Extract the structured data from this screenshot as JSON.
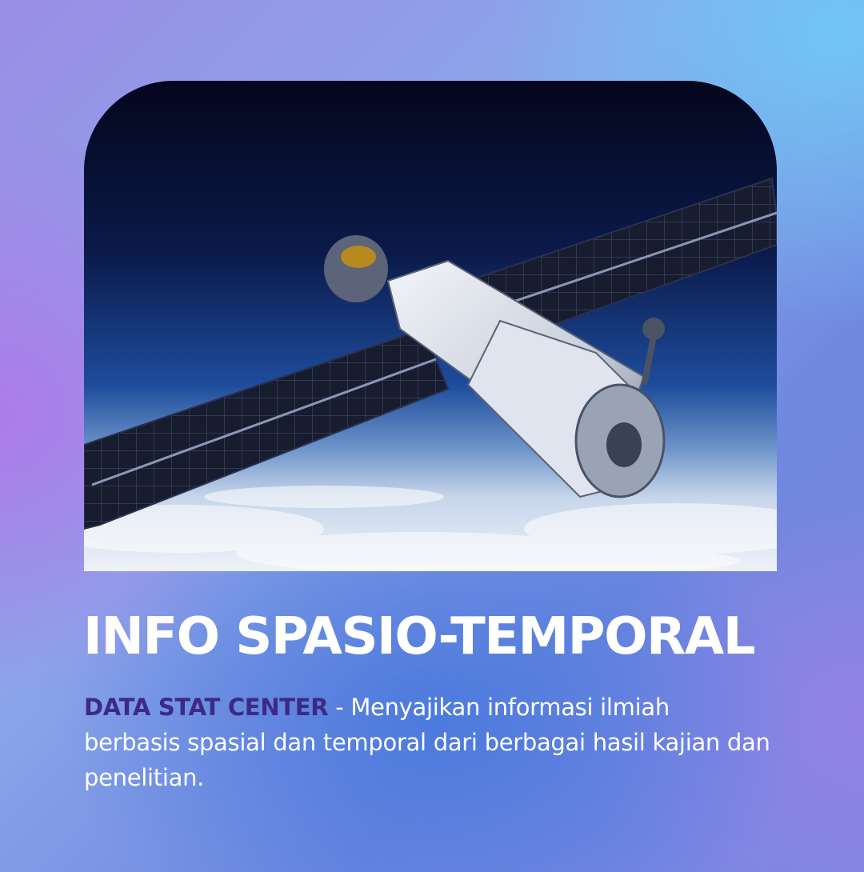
{
  "hero_image": {
    "icon": "satellite-over-earth-photo",
    "colors": {
      "space": "#050a2a",
      "horizon": "#1c4b9e",
      "clouds": "#e6edf6",
      "panel": "#1b2136",
      "module": "#dfe4ee"
    }
  },
  "title": "INFO SPASIO-TEMPORAL",
  "description": {
    "brand": "DATA STAT CENTER",
    "text": " - Menyajikan informasi ilmiah berbasis spasial dan temporal dari berbagai hasil kajian dan penelitian."
  },
  "colors": {
    "brand": "#3d2a86",
    "text": "#ffffff"
  }
}
